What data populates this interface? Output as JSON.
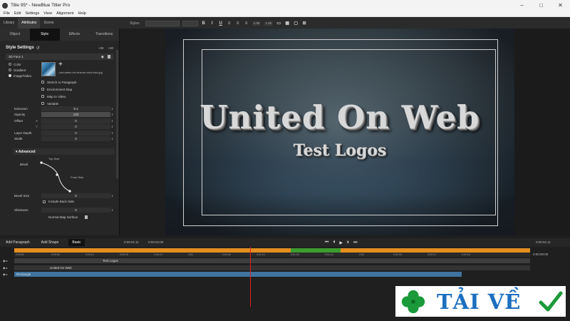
{
  "window": {
    "title": "Title 95* - NewBlue Titler Pro",
    "controls": [
      "–",
      "□",
      "✕"
    ]
  },
  "menu": [
    "File",
    "Edit",
    "Settings",
    "View",
    "Alignment",
    "Help"
  ],
  "top_tabs": [
    "Library",
    "Attributes",
    "Scene"
  ],
  "toolbar": {
    "styles_label": "Styles",
    "size_a": "1.00",
    "size_b": "1.00"
  },
  "sub_tabs": [
    "Object",
    "Style",
    "Effects",
    "Transitions"
  ],
  "style_settings": {
    "title": "Style Settings",
    "reset_icon": "↺",
    "plus_label": "+30",
    "plus_label2": "+30",
    "face_label": "3D Face 1",
    "fill_options": [
      "Color",
      "Gradient",
      "Image/Video"
    ],
    "filename": "...tart-water-ice-texture-ertut-edz.jpg",
    "checkboxes": [
      "Stretch to Paragraph",
      "Environment Map",
      "Map to Video",
      "Variable"
    ],
    "props": [
      {
        "label": "Extrusion",
        "axis": "",
        "value": "9.1"
      },
      {
        "label": "Opacity",
        "axis": "",
        "value": "100"
      },
      {
        "label": "Offset",
        "axis": "X",
        "value": "0"
      },
      {
        "label": "",
        "axis": "Y",
        "value": "0"
      },
      {
        "label": "Layer Depth",
        "axis": "",
        "value": "0"
      },
      {
        "label": "Width",
        "axis": "",
        "value": "0"
      }
    ],
    "advanced": "▾ Advanced",
    "bevel_label": "Bevel",
    "top_side": "Top Side",
    "front_side": "Front Side",
    "bevel_size": {
      "label": "Bevel Size",
      "value": "0"
    },
    "include_back": "Include Back Side",
    "shininess": {
      "label": "Shininess",
      "value": "0"
    },
    "normal_map": "Normal Map Surface"
  },
  "canvas": {
    "headline": "United On Web",
    "subline": "Test Logos"
  },
  "bottom_bar": {
    "add_paragraph": "Add Paragraph",
    "add_shape": "Add Shape",
    "basic": "Basic",
    "tc_left": "0:00:01:11",
    "tc_mid": "0:00:04:00",
    "tc_right": "0:00:01:11"
  },
  "timeline": {
    "ticks": [
      "0:00:00",
      "0:00:06",
      "0:00:12",
      "0:00:18",
      "0:00:24",
      "0:01",
      "0:01:06",
      "0:01:12",
      "0:01:18",
      "0:01:24",
      "0:02",
      "0:02:06",
      "0:02:12",
      "0:02:18"
    ],
    "tracks": [
      "Test Logos",
      "United On Web",
      "Rectangle"
    ],
    "right_tc": "0:00:00:00"
  },
  "watermark": {
    "text": "TẢI VỀ",
    "clover_color": "#1a9a3a",
    "text_color": "#1b6fc0"
  }
}
